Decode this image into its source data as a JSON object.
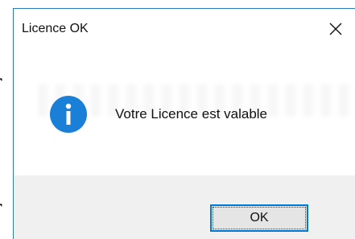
{
  "background": {
    "lines": [
      "r",
      ":",
      "r"
    ]
  },
  "dialog": {
    "title": "Licence OK",
    "message": "Votre Licence est valable",
    "ok_label": "OK",
    "icon": "info-icon",
    "close_icon": "close-icon"
  },
  "colors": {
    "border": "#2b79c2",
    "icon_blue": "#1a7fd6",
    "footer_bg": "#f0f0f0",
    "button_focus": "#0078d7"
  }
}
